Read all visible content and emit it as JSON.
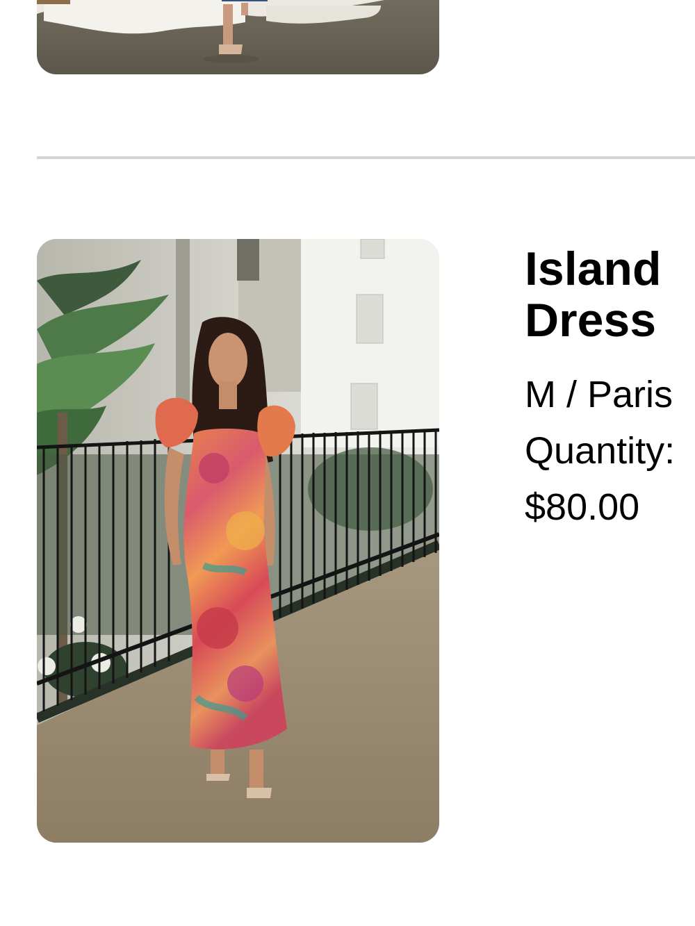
{
  "cart": {
    "items": [
      {
        "image_alt": "Model wearing a denim top with white skirt and clear heels"
      },
      {
        "title_line1": "Island",
        "title_line2": "Dress",
        "variant": "M / Paris",
        "quantity_label": "Quantity:",
        "price": "$80.00",
        "image_alt": "Model wearing a long floral satin dress with ruffled sleeves"
      }
    ]
  },
  "colors": {
    "divider": "#d4d4d4",
    "text": "#000000"
  }
}
